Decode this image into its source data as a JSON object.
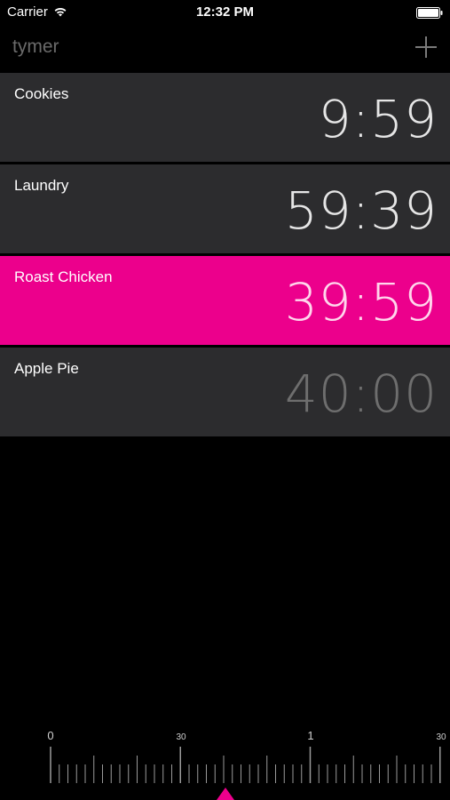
{
  "status_bar": {
    "carrier": "Carrier",
    "time": "12:32 PM"
  },
  "nav": {
    "title": "tymer"
  },
  "timers": [
    {
      "name": "Cookies",
      "time": "9:59",
      "state": "running"
    },
    {
      "name": "Laundry",
      "time": "59:39",
      "state": "running"
    },
    {
      "name": "Roast Chicken",
      "time": "39:59",
      "state": "active"
    },
    {
      "name": "Apple Pie",
      "time": "40:00",
      "state": "paused"
    }
  ],
  "scrubber": {
    "labels": [
      "0",
      "30",
      "1",
      "30"
    ]
  },
  "colors": {
    "accent": "#ec008c",
    "row_bg": "#2c2c2e",
    "background": "#000000"
  }
}
